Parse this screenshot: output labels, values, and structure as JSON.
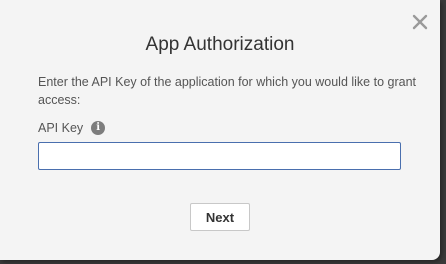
{
  "dialog": {
    "title": "App Authorization",
    "description": "Enter the API Key of the application for which you would like to grant access:",
    "close_icon": "close-icon",
    "field": {
      "label": "API Key",
      "info_icon": "info-icon",
      "info_glyph": "i",
      "value": "",
      "placeholder": ""
    },
    "next_label": "Next"
  },
  "colors": {
    "dialog_bg": "#f4f4f4",
    "input_border": "#4a6fae",
    "text": "#333333"
  }
}
